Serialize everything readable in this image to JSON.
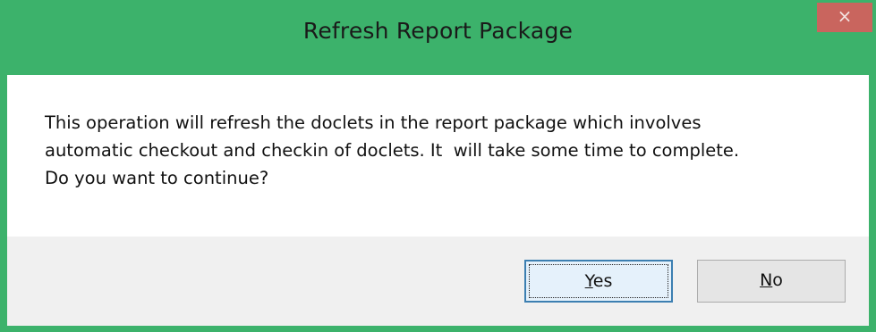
{
  "dialog": {
    "title": "Refresh Report Package",
    "close_glyph": "×",
    "message_lines": [
      "This operation will refresh the doclets in the report package which involves",
      "automatic checkout and checkin of doclets. It  will take some time to complete.",
      "Do you want to continue?"
    ],
    "buttons": {
      "yes": {
        "mnemonic": "Y",
        "rest": "es"
      },
      "no": {
        "mnemonic": "N",
        "rest": "o"
      }
    }
  },
  "colors": {
    "frame": "#3cb26b",
    "close_button": "#c9655e",
    "footer": "#f0f0f0",
    "default_button_border": "#3c7fb1"
  },
  "icons": {
    "close": "close-icon"
  }
}
